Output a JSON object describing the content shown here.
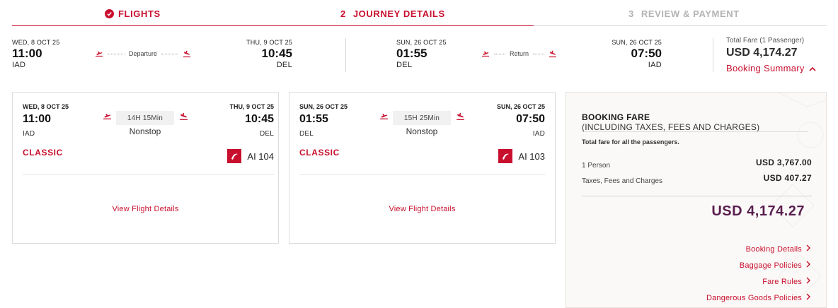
{
  "stepper": {
    "steps": [
      {
        "num": "",
        "label": "FLIGHTS"
      },
      {
        "num": "2",
        "label": "JOURNEY DETAILS"
      },
      {
        "num": "3",
        "label": "REVIEW & PAYMENT"
      }
    ]
  },
  "summary": {
    "outbound": {
      "dep_date": "WED, 8 OCT 25",
      "dep_time": "11:00",
      "dep_code": "IAD",
      "label": "Departure",
      "arr_date": "THU, 9 OCT 25",
      "arr_time": "10:45",
      "arr_code": "DEL"
    },
    "return": {
      "dep_date": "SUN, 26 OCT 25",
      "dep_time": "01:55",
      "dep_code": "DEL",
      "label": "Return",
      "arr_date": "SUN, 26 OCT 25",
      "arr_time": "07:50",
      "arr_code": "IAD"
    },
    "total_label": "Total Fare (1 Passenger)",
    "total_amount": "USD 4,174.27",
    "booking_summary": "Booking Summary"
  },
  "cards": [
    {
      "dep_date": "WED, 8 OCT 25",
      "dep_time": "11:00",
      "dep_code": "IAD",
      "duration": "14H 15Min",
      "stops": "Nonstop",
      "arr_date": "THU, 9 OCT 25",
      "arr_time": "10:45",
      "arr_code": "DEL",
      "cabin": "CLASSIC",
      "flight_no": "AI 104",
      "view_details": "View Flight Details"
    },
    {
      "dep_date": "SUN, 26 OCT 25",
      "dep_time": "01:55",
      "dep_code": "DEL",
      "duration": "15H 25Min",
      "stops": "Nonstop",
      "arr_date": "SUN, 26 OCT 25",
      "arr_time": "07:50",
      "arr_code": "IAD",
      "cabin": "CLASSIC",
      "flight_no": "AI 103",
      "view_details": "View Flight Details"
    }
  ],
  "fare": {
    "title": "BOOKING FARE",
    "subtitle": "(INCLUDING TAXES, FEES AND CHARGES)",
    "note": "Total fare for all the passengers.",
    "rows": [
      {
        "label": "1 Person",
        "amount": "USD 3,767.00"
      },
      {
        "label": "Taxes, Fees and Charges",
        "amount": "USD 407.27"
      }
    ],
    "total": "USD 4,174.27",
    "links": [
      "Booking Details",
      "Baggage Policies",
      "Fare Rules",
      "Dangerous Goods Policies"
    ]
  },
  "colors": {
    "accent": "#c8102e",
    "total": "#5a1e4f",
    "muted": "#b3b3b3"
  },
  "icons": [
    "check-circle-icon",
    "takeoff-icon",
    "landing-icon",
    "chevron-up-icon",
    "chevron-right-icon",
    "air-india-logo"
  ]
}
